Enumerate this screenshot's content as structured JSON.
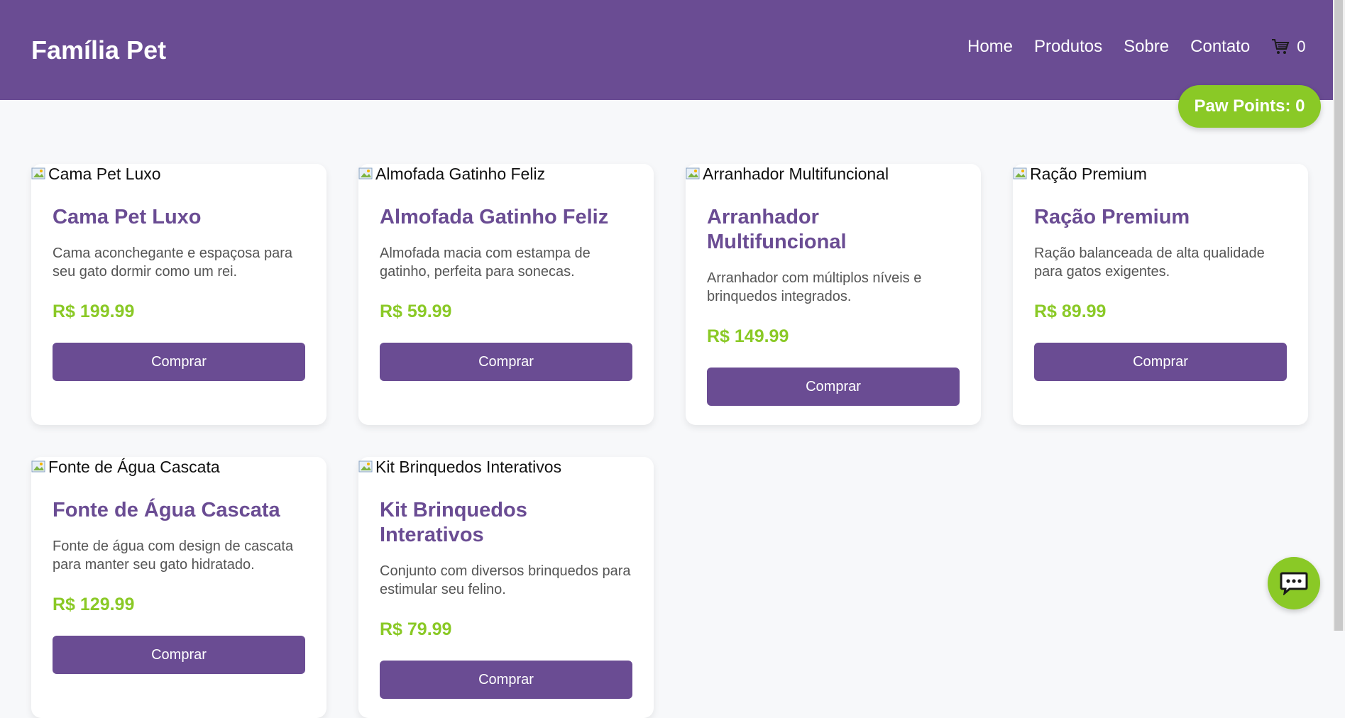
{
  "header": {
    "brand": "Família Pet",
    "nav": [
      "Home",
      "Produtos",
      "Sobre",
      "Contato"
    ],
    "cart_icon": "cart-icon",
    "cart_count": "0"
  },
  "paw_points": "Paw Points: 0",
  "products": [
    {
      "image_alt": "Cama Pet Luxo",
      "title": "Cama Pet Luxo",
      "description": "Cama aconchegante e espaçosa para seu gato dormir como um rei.",
      "price": "R$ 199.99",
      "button": "Comprar"
    },
    {
      "image_alt": "Almofada Gatinho Feliz",
      "title": "Almofada Gatinho Feliz",
      "description": "Almofada macia com estampa de gatinho, perfeita para sonecas.",
      "price": "R$ 59.99",
      "button": "Comprar"
    },
    {
      "image_alt": "Arranhador Multifuncional",
      "title": "Arranhador Multifuncional",
      "description": "Arranhador com múltiplos níveis e brinquedos integrados.",
      "price": "R$ 149.99",
      "button": "Comprar"
    },
    {
      "image_alt": "Ração Premium",
      "title": "Ração Premium",
      "description": "Ração balanceada de alta qualidade para gatos exigentes.",
      "price": "R$ 89.99",
      "button": "Comprar"
    },
    {
      "image_alt": "Fonte de Água Cascata",
      "title": "Fonte de Água Cascata",
      "description": "Fonte de água com design de cascata para manter seu gato hidratado.",
      "price": "R$ 129.99",
      "button": "Comprar"
    },
    {
      "image_alt": "Kit Brinquedos Interativos",
      "title": "Kit Brinquedos Interativos",
      "description": "Conjunto com diversos brinquedos para estimular seu felino.",
      "price": "R$ 79.99",
      "button": "Comprar"
    }
  ],
  "chat_icon": "chat-bubble-icon",
  "colors": {
    "primary": "#6a4c93",
    "accent": "#8ac926",
    "background": "#f7f8fa"
  }
}
